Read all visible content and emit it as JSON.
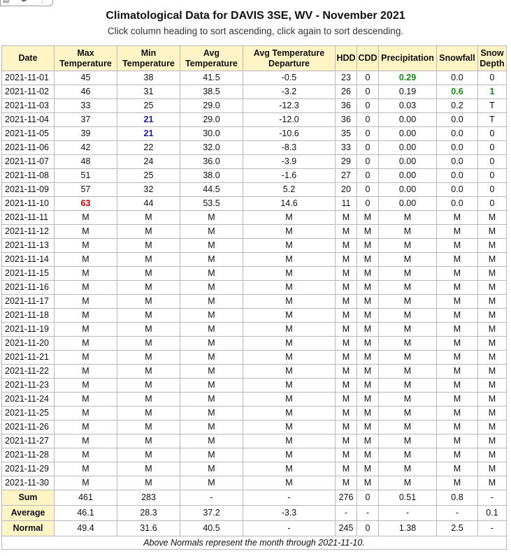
{
  "page": {
    "title": "Climatological Data for DAVIS 3SE, WV - November 2021",
    "subtitle": "Click column heading to sort ascending, click again to sort descending."
  },
  "colors": {
    "header_bg": "#fff4c6",
    "max_high": "#cc0000",
    "min_low": "#1a1aa8",
    "precip_snow_high": "#118811"
  },
  "table": {
    "columns": [
      {
        "key": "date",
        "label": "Date",
        "width": 75
      },
      {
        "key": "max",
        "label": "Max Temperature",
        "width": 90
      },
      {
        "key": "min",
        "label": "Min Temperature",
        "width": 90
      },
      {
        "key": "avg",
        "label": "Avg Temperature",
        "width": 90
      },
      {
        "key": "dep",
        "label": "Avg Temperature Departure",
        "width": 132
      },
      {
        "key": "hdd",
        "label": "HDD",
        "width": 31
      },
      {
        "key": "cdd",
        "label": "CDD",
        "width": 31
      },
      {
        "key": "pcpn",
        "label": "Precipitation",
        "width": 83
      },
      {
        "key": "snow",
        "label": "Snowfall",
        "width": 59
      },
      {
        "key": "snwd",
        "label": "Snow Depth",
        "width": 41
      }
    ],
    "rows": [
      [
        "2021-11-01",
        "45",
        "38",
        "41.5",
        "-0.5",
        "23",
        "0",
        "0.29",
        "0.0",
        "0"
      ],
      [
        "2021-11-02",
        "46",
        "31",
        "38.5",
        "-3.2",
        "26",
        "0",
        "0.19",
        "0.6",
        "1"
      ],
      [
        "2021-11-03",
        "33",
        "25",
        "29.0",
        "-12.3",
        "36",
        "0",
        "0.03",
        "0.2",
        "T"
      ],
      [
        "2021-11-04",
        "37",
        "21",
        "29.0",
        "-12.0",
        "36",
        "0",
        "0.00",
        "0.0",
        "T"
      ],
      [
        "2021-11-05",
        "39",
        "21",
        "30.0",
        "-10.6",
        "35",
        "0",
        "0.00",
        "0.0",
        "0"
      ],
      [
        "2021-11-06",
        "42",
        "22",
        "32.0",
        "-8.3",
        "33",
        "0",
        "0.00",
        "0.0",
        "0"
      ],
      [
        "2021-11-07",
        "48",
        "24",
        "36.0",
        "-3.9",
        "29",
        "0",
        "0.00",
        "0.0",
        "0"
      ],
      [
        "2021-11-08",
        "51",
        "25",
        "38.0",
        "-1.6",
        "27",
        "0",
        "0.00",
        "0.0",
        "0"
      ],
      [
        "2021-11-09",
        "57",
        "32",
        "44.5",
        "5.2",
        "20",
        "0",
        "0.00",
        "0.0",
        "0"
      ],
      [
        "2021-11-10",
        "63",
        "44",
        "53.5",
        "14.6",
        "11",
        "0",
        "0.00",
        "0.0",
        "0"
      ],
      [
        "2021-11-11",
        "M",
        "M",
        "M",
        "M",
        "M",
        "M",
        "M",
        "M",
        "M"
      ],
      [
        "2021-11-12",
        "M",
        "M",
        "M",
        "M",
        "M",
        "M",
        "M",
        "M",
        "M"
      ],
      [
        "2021-11-13",
        "M",
        "M",
        "M",
        "M",
        "M",
        "M",
        "M",
        "M",
        "M"
      ],
      [
        "2021-11-14",
        "M",
        "M",
        "M",
        "M",
        "M",
        "M",
        "M",
        "M",
        "M"
      ],
      [
        "2021-11-15",
        "M",
        "M",
        "M",
        "M",
        "M",
        "M",
        "M",
        "M",
        "M"
      ],
      [
        "2021-11-16",
        "M",
        "M",
        "M",
        "M",
        "M",
        "M",
        "M",
        "M",
        "M"
      ],
      [
        "2021-11-17",
        "M",
        "M",
        "M",
        "M",
        "M",
        "M",
        "M",
        "M",
        "M"
      ],
      [
        "2021-11-18",
        "M",
        "M",
        "M",
        "M",
        "M",
        "M",
        "M",
        "M",
        "M"
      ],
      [
        "2021-11-19",
        "M",
        "M",
        "M",
        "M",
        "M",
        "M",
        "M",
        "M",
        "M"
      ],
      [
        "2021-11-20",
        "M",
        "M",
        "M",
        "M",
        "M",
        "M",
        "M",
        "M",
        "M"
      ],
      [
        "2021-11-21",
        "M",
        "M",
        "M",
        "M",
        "M",
        "M",
        "M",
        "M",
        "M"
      ],
      [
        "2021-11-22",
        "M",
        "M",
        "M",
        "M",
        "M",
        "M",
        "M",
        "M",
        "M"
      ],
      [
        "2021-11-23",
        "M",
        "M",
        "M",
        "M",
        "M",
        "M",
        "M",
        "M",
        "M"
      ],
      [
        "2021-11-24",
        "M",
        "M",
        "M",
        "M",
        "M",
        "M",
        "M",
        "M",
        "M"
      ],
      [
        "2021-11-25",
        "M",
        "M",
        "M",
        "M",
        "M",
        "M",
        "M",
        "M",
        "M"
      ],
      [
        "2021-11-26",
        "M",
        "M",
        "M",
        "M",
        "M",
        "M",
        "M",
        "M",
        "M"
      ],
      [
        "2021-11-27",
        "M",
        "M",
        "M",
        "M",
        "M",
        "M",
        "M",
        "M",
        "M"
      ],
      [
        "2021-11-28",
        "M",
        "M",
        "M",
        "M",
        "M",
        "M",
        "M",
        "M",
        "M"
      ],
      [
        "2021-11-29",
        "M",
        "M",
        "M",
        "M",
        "M",
        "M",
        "M",
        "M",
        "M"
      ],
      [
        "2021-11-30",
        "M",
        "M",
        "M",
        "M",
        "M",
        "M",
        "M",
        "M",
        "M"
      ]
    ],
    "highlights": [
      {
        "row": 9,
        "col": 1,
        "style": "red"
      },
      {
        "row": 3,
        "col": 2,
        "style": "blue"
      },
      {
        "row": 4,
        "col": 2,
        "style": "blue"
      },
      {
        "row": 0,
        "col": 7,
        "style": "green"
      },
      {
        "row": 1,
        "col": 8,
        "style": "green"
      },
      {
        "row": 1,
        "col": 9,
        "style": "green"
      }
    ],
    "summary": [
      {
        "label": "Sum",
        "values": [
          "461",
          "283",
          "-",
          "-",
          "276",
          "0",
          "0.51",
          "0.8",
          "-"
        ]
      },
      {
        "label": "Average",
        "values": [
          "46.1",
          "28.3",
          "37.2",
          "-3.3",
          "-",
          "-",
          "-",
          "-",
          "0.1"
        ]
      },
      {
        "label": "Normal",
        "values": [
          "49.4",
          "31.6",
          "40.5",
          "-",
          "245",
          "0",
          "1.38",
          "2.5",
          "-"
        ]
      }
    ],
    "footnote": "Above Normals represent the month through 2021-11-10."
  }
}
